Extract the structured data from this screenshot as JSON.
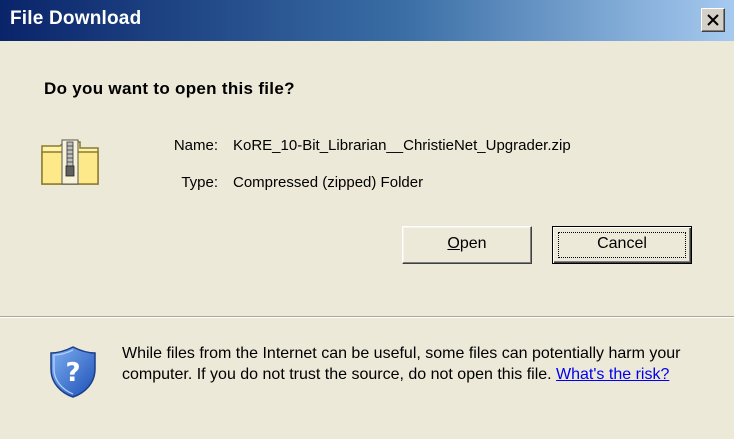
{
  "window": {
    "title": "File Download",
    "close_glyph": "close-icon"
  },
  "prompt": {
    "question": "Do you want to open this file?"
  },
  "file": {
    "icon": "zip-folder-icon",
    "name_label": "Name:",
    "name_value": "KoRE_10-Bit_Librarian__ChristieNet_Upgrader.zip",
    "type_label": "Type:",
    "type_value": "Compressed (zipped) Folder"
  },
  "buttons": {
    "open_mnemonic": "O",
    "open_rest": "pen",
    "cancel": "Cancel"
  },
  "warning": {
    "icon": "shield-question-icon",
    "text": "While files from the Internet can be useful, some files can potentially harm your computer. If you do not trust the source, do not open this file. ",
    "link": "What's the risk?"
  },
  "colors": {
    "title_bar_start": "#0a246a",
    "title_bar_end": "#a6caf0",
    "dialog_background": "#ece9d8",
    "link": "#0000ee"
  }
}
